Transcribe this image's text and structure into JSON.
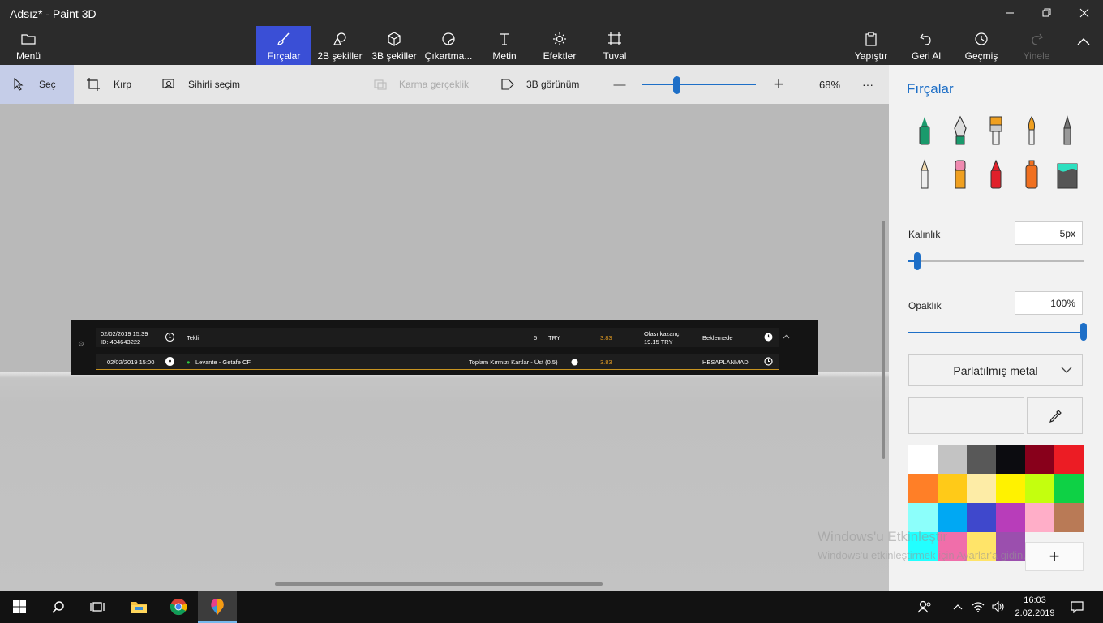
{
  "window": {
    "title": "Adsız* - Paint 3D"
  },
  "ribbon": {
    "menu": "Menü",
    "tools": [
      {
        "id": "brushes",
        "label": "Fırçalar",
        "icon": "brush-icon",
        "active": true
      },
      {
        "id": "2d-shapes",
        "label": "2B şekiller",
        "icon": "2d-shapes-icon"
      },
      {
        "id": "3d-shapes",
        "label": "3B şekiller",
        "icon": "3d-cube-icon"
      },
      {
        "id": "stickers",
        "label": "Çıkartma...",
        "icon": "sticker-icon"
      },
      {
        "id": "text",
        "label": "Metin",
        "icon": "text-icon"
      },
      {
        "id": "effects",
        "label": "Efektler",
        "icon": "sun-icon"
      },
      {
        "id": "canvas",
        "label": "Tuval",
        "icon": "canvas-icon"
      }
    ],
    "actions": [
      {
        "id": "paste",
        "label": "Yapıştır",
        "icon": "paste-icon"
      },
      {
        "id": "undo",
        "label": "Geri Al",
        "icon": "undo-icon"
      },
      {
        "id": "history",
        "label": "Geçmiş",
        "icon": "history-icon"
      },
      {
        "id": "redo",
        "label": "Yinele",
        "icon": "redo-icon",
        "disabled": true
      }
    ]
  },
  "subtoolbar": {
    "select": "Seç",
    "crop": "Kırp",
    "magic_select": "Sihirli seçim",
    "mixed_reality": "Karma gerçeklik",
    "view_3d": "3B görünüm",
    "zoom_out": "—",
    "zoom_in": "+",
    "zoom_fraction": 0.3,
    "zoom": "68%",
    "more": "···"
  },
  "canvas_image": {
    "row1": {
      "date": "02/02/2019 15:39",
      "id": "ID: 404643222",
      "num_icon": "1",
      "type": "Tekli",
      "stake": "5",
      "currency": "TRY",
      "odds": "3.83",
      "potential_label": "Olası kazanç:",
      "potential_value": "19.15 TRY",
      "status": "Beklemede"
    },
    "row2": {
      "date": "02/02/2019 15:00",
      "match": "Levante - Getafe CF",
      "market": "Toplam Kırmızı Kartlar - Üst (0.5)",
      "odds": "3.83",
      "status": "HESAPLANMADI"
    }
  },
  "panel": {
    "title": "Fırçalar",
    "thickness_label": "Kalınlık",
    "thickness_value": "5px",
    "thickness_fraction": 0.05,
    "opacity_label": "Opaklık",
    "opacity_value": "100%",
    "opacity_fraction": 1.0,
    "material": "Parlatılmış metal",
    "swatches": [
      "#ffffff",
      "#c3c3c3",
      "#585858",
      "#0c0c10",
      "#88001b",
      "#ec1c24",
      "#ff7f27",
      "#ffca18",
      "#fdeca6",
      "#fff200",
      "#c4ff0e",
      "#0ed145",
      "#8cfffb",
      "#00a8f3",
      "#3f48cc",
      "#b83dba",
      "#ffaec8",
      "#b97a56",
      "#22ffff",
      "#f06eaa",
      "#ffe469",
      "#9b4fae"
    ],
    "add_color": "+"
  },
  "watermark": {
    "line1": "Windows'u Etkinleştir",
    "line2": "Windows'u etkinleştirmek için Ayarlar'a gidin."
  },
  "taskbar": {
    "time": "16:03",
    "date": "2.02.2019"
  }
}
